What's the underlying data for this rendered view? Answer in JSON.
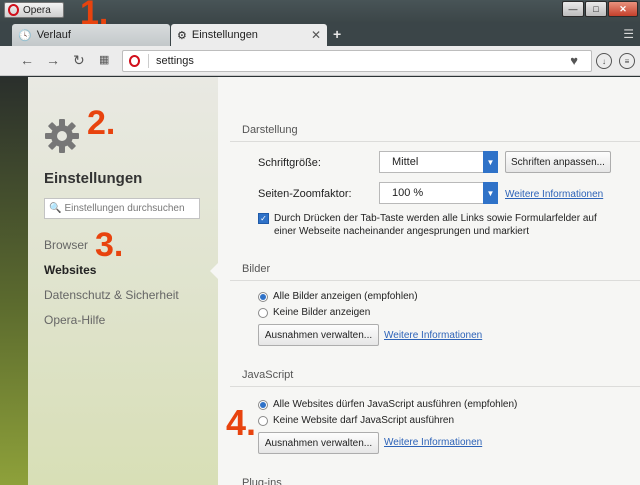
{
  "window": {
    "menu_label": "Opera",
    "controls": {
      "minimize": "—",
      "maximize": "□",
      "close": "✕"
    }
  },
  "tabs": [
    {
      "label": "Verlauf",
      "icon": "clock-icon",
      "active": false
    },
    {
      "label": "Einstellungen",
      "icon": "gear-icon",
      "active": true
    }
  ],
  "toolbar": {
    "address": "settings",
    "buttons": [
      "back-icon",
      "forward-icon",
      "reload-icon",
      "speed-dial-icon"
    ]
  },
  "sidebar": {
    "title": "Einstellungen",
    "search_placeholder": "Einstellungen durchsuchen",
    "items": [
      {
        "label": "Browser",
        "active": false
      },
      {
        "label": "Websites",
        "active": true
      },
      {
        "label": "Datenschutz & Sicherheit",
        "active": false
      },
      {
        "label": "Opera-Hilfe",
        "active": false
      }
    ]
  },
  "sections": {
    "darstellung": {
      "title": "Darstellung",
      "font_size_label": "Schriftgröße:",
      "font_size_value": "Mittel",
      "fonts_button": "Schriften anpassen...",
      "zoom_label": "Seiten-Zoomfaktor:",
      "zoom_value": "100 %",
      "zoom_link": "Weitere Informationen",
      "tab_checkbox": "Durch Drücken der Tab-Taste werden alle Links sowie Formularfelder auf einer Webseite nacheinander angesprungen und markiert",
      "tab_checked": true
    },
    "bilder": {
      "title": "Bilder",
      "options": [
        "Alle Bilder anzeigen (empfohlen)",
        "Keine Bilder anzeigen"
      ],
      "selected": 0,
      "button": "Ausnahmen verwalten...",
      "link": "Weitere Informationen"
    },
    "javascript": {
      "title": "JavaScript",
      "options": [
        "Alle Websites dürfen JavaScript ausführen (empfohlen)",
        "Keine Website darf JavaScript ausführen"
      ],
      "selected": 0,
      "button": "Ausnahmen verwalten...",
      "link": "Weitere Informationen"
    },
    "plugins": {
      "title": "Plug-ins"
    }
  },
  "markers": [
    "1.",
    "2.",
    "3.",
    "4."
  ],
  "colors": {
    "accent": "#2f72c8",
    "marker": "#e8430e",
    "opera_red": "#d10f1b"
  }
}
